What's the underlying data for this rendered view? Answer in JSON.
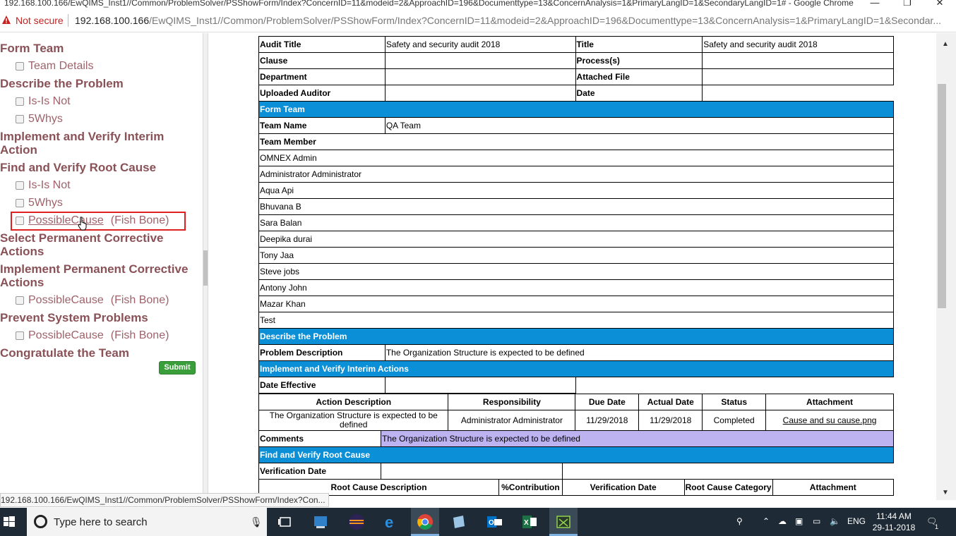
{
  "window": {
    "title": "192.168.100.166/EwQIMS_Inst1//Common/ProblemSolver/PSShowForm/Index?ConcernID=11&modeid=2&ApproachID=196&Documenttype=13&ConcernAnalysis=1&PrimaryLangID=1&SecondaryLangID=1# - Google Chrome",
    "minimize": "—",
    "restore": "❐",
    "close": "✕"
  },
  "address": {
    "not_secure": "Not secure",
    "host": "192.168.100.166",
    "path": "/EwQIMS_Inst1//Common/ProblemSolver/PSShowForm/Index?ConcernID=11&modeid=2&ApproachID=196&Documenttype=13&ConcernAnalysis=1&PrimaryLangID=1&Secondar..."
  },
  "sidebar": {
    "form_team": "Form Team",
    "team_details": "Team Details",
    "describe_problem": "Describe the Problem",
    "is_is_not_1": "Is-Is Not",
    "whys_1": "5Whys",
    "implement_interim_1": "Implement and Verify Interim",
    "implement_interim_2": "Action",
    "find_root_cause": "Find and Verify Root Cause",
    "is_is_not_2": "Is-Is Not",
    "whys_2": "5Whys",
    "possible_cause_1": "PossibleCause",
    "fish_bone_1": "(Fish Bone)",
    "select_permanent_1": "Select Permanent Corrective",
    "select_permanent_2": "Actions",
    "implement_permanent_1": "Implement Permanent Corrective",
    "implement_permanent_2": "Actions",
    "possible_cause_2": "PossibleCause",
    "fish_bone_2": "(Fish Bone)",
    "prevent_problems": "Prevent System Problems",
    "possible_cause_3": "PossibleCause",
    "fish_bone_3": "(Fish Bone)",
    "congratulate": "Congratulate the Team",
    "submit": "Submit"
  },
  "report": {
    "audit_title_label": "Audit Title",
    "audit_title_value": "Safety and security audit 2018",
    "title_label": "Title",
    "title_value": "Safety and security audit 2018",
    "clause_label": "Clause",
    "processes_label": "Process(s)",
    "department_label": "Department",
    "attached_file_label": "Attached File",
    "uploaded_auditor_label": "Uploaded Auditor",
    "date_label": "Date",
    "form_team_section": "Form Team",
    "team_name_label": "Team Name",
    "team_name_value": "QA Team",
    "team_member_label": "Team Member",
    "members": [
      "OMNEX Admin",
      "Administrator Administrator",
      "Aqua Api",
      "Bhuvana B",
      "Sara Balan",
      "Deepika durai",
      "Tony Jaa",
      "Steve jobs",
      "Antony John",
      "Mazar Khan",
      "Test"
    ],
    "describe_section": "Describe the Problem",
    "problem_desc_label": "Problem Description",
    "problem_desc_value": "The Organization Structure is expected to be defined",
    "interim_section": "Implement and Verify Interim Actions",
    "date_effective_label": "Date Effective",
    "action_headers": [
      "Action Description",
      "Responsibility",
      "Due Date",
      "Actual Date",
      "Status",
      "Attachment"
    ],
    "action_desc_line1": "The Organization Structure is expected to be",
    "action_desc_line2": "defined",
    "action_responsibility": "Administrator Administrator",
    "action_due": "11/29/2018",
    "action_actual": "11/29/2018",
    "action_status": "Completed",
    "action_attachment": "Cause and su cause.png",
    "comments_label": "Comments",
    "comments_value": "The Organization Structure is expected to be defined",
    "root_section": "Find and Verify Root Cause",
    "verification_date_label": "Verification Date",
    "root_headers": [
      "Root Cause Description",
      "%Contribution",
      "Verification Date",
      "Root Cause Category",
      "Attachment"
    ]
  },
  "status_url": "192.168.100.166/EwQIMS_Inst1//Common/ProblemSolver/PSShowForm/Index?Con...",
  "taskbar": {
    "search_placeholder": "Type here to search",
    "lang": "ENG",
    "time": "11:44 AM",
    "date": "29-11-2018",
    "notification_count": "1"
  }
}
